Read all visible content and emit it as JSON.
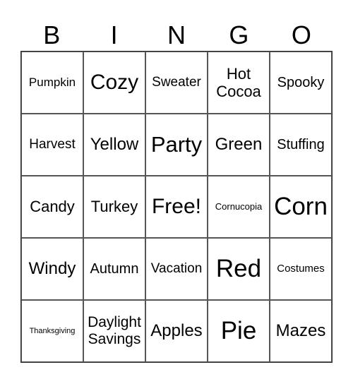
{
  "header": [
    "B",
    "I",
    "N",
    "G",
    "O"
  ],
  "rows": [
    [
      "Pumpkin",
      "Cozy",
      "Sweater",
      "Hot Cocoa",
      "Spooky"
    ],
    [
      "Harvest",
      "Yellow",
      "Party",
      "Green",
      "Stuffing"
    ],
    [
      "Candy",
      "Turkey",
      "Free!",
      "Cornucopia",
      "Corn"
    ],
    [
      "Windy",
      "Autumn",
      "Vacation",
      "Red",
      "Costumes"
    ],
    [
      "Thanksgiving",
      "Daylight Savings",
      "Apples",
      "Pie",
      "Mazes"
    ]
  ]
}
